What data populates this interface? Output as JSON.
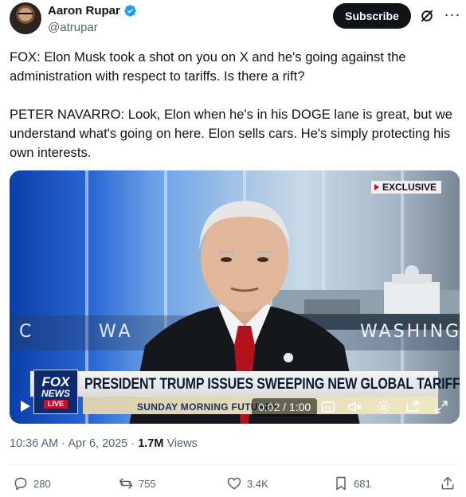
{
  "author": {
    "display_name": "Aaron Rupar",
    "handle": "@atrupar",
    "verified_color": "#1d9bf0"
  },
  "header": {
    "subscribe_label": "Subscribe"
  },
  "tweet": {
    "paragraphs": [
      "FOX: Elon Musk took a shot on you on X and he's going against the administration with respect to tariffs. Is there a rift?",
      "PETER NAVARRO: Look, Elon when he's in his DOGE lane is great, but we understand what's going on here. Elon sells cars. He's simply protecting his own interests."
    ]
  },
  "video": {
    "badge": "EXCLUSIVE",
    "backdrop_left": "C",
    "backdrop_mid": "WA",
    "backdrop_right": "WASHING",
    "headline": "PRESIDENT TRUMP ISSUES SWEEPING NEW GLOBAL TARIFFS",
    "ticker": "SUNDAY MORNING FUTURES",
    "network_logo_top": "FOX",
    "network_logo_bottom": "NEWS",
    "network_live": "LIVE",
    "time_display": "0:02 / 1:00",
    "controls": [
      "play-icon",
      "captions-icon",
      "mute-icon",
      "settings-icon",
      "pip-icon",
      "fullscreen-icon"
    ]
  },
  "meta": {
    "timestamp": "10:36 AM · Apr 6, 2025 · ",
    "views_count": "1.7M",
    "views_label": " Views"
  },
  "actions": {
    "replies": "280",
    "reposts": "755",
    "likes": "3.4K",
    "bookmarks": "681"
  },
  "colors": {
    "text_primary": "#0f1419",
    "text_secondary": "#536471",
    "accent": "#1d9bf0",
    "fox_red": "#c8102e",
    "fox_blue": "#0e2a6e"
  }
}
